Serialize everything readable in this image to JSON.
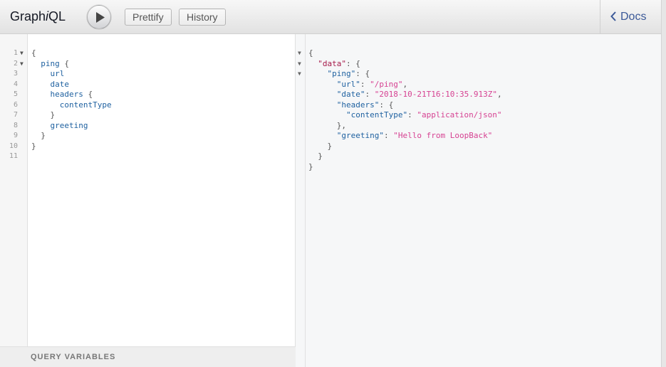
{
  "app": {
    "title_prefix": "Graph",
    "title_italic": "i",
    "title_suffix": "QL"
  },
  "toolbar": {
    "execute_label": "Execute",
    "prettify_label": "Prettify",
    "history_label": "History"
  },
  "docs": {
    "label": "Docs"
  },
  "query": {
    "lines": [
      {
        "num": "1",
        "fold": "▼",
        "text": "{"
      },
      {
        "num": "2",
        "fold": "▼",
        "text": "  ping {"
      },
      {
        "num": "3",
        "fold": "",
        "text": "    url"
      },
      {
        "num": "4",
        "fold": "",
        "text": "    date"
      },
      {
        "num": "5",
        "fold": "",
        "text": "    headers {"
      },
      {
        "num": "6",
        "fold": "",
        "text": "      contentType"
      },
      {
        "num": "7",
        "fold": "",
        "text": "    }"
      },
      {
        "num": "8",
        "fold": "",
        "text": "    greeting"
      },
      {
        "num": "9",
        "fold": "",
        "text": "  }"
      },
      {
        "num": "10",
        "fold": "",
        "text": "}"
      },
      {
        "num": "11",
        "fold": "",
        "text": ""
      }
    ]
  },
  "variables": {
    "label": "QUERY VARIABLES"
  },
  "result": {
    "lines": [
      {
        "fold": "▼",
        "text": "{"
      },
      {
        "fold": "▼",
        "text": "  \"data\": {"
      },
      {
        "fold": "▼",
        "text": "    \"ping\": {"
      },
      {
        "fold": "",
        "text": "      \"url\": \"/ping\","
      },
      {
        "fold": "",
        "text": "      \"date\": \"2018-10-21T16:10:35.913Z\","
      },
      {
        "fold": "",
        "text": "      \"headers\": {"
      },
      {
        "fold": "",
        "text": "        \"contentType\": \"application/json\""
      },
      {
        "fold": "",
        "text": "      },"
      },
      {
        "fold": "",
        "text": "      \"greeting\": \"Hello from LoopBack\""
      },
      {
        "fold": "",
        "text": "    }"
      },
      {
        "fold": "",
        "text": "  }"
      },
      {
        "fold": "",
        "text": "}"
      }
    ]
  }
}
